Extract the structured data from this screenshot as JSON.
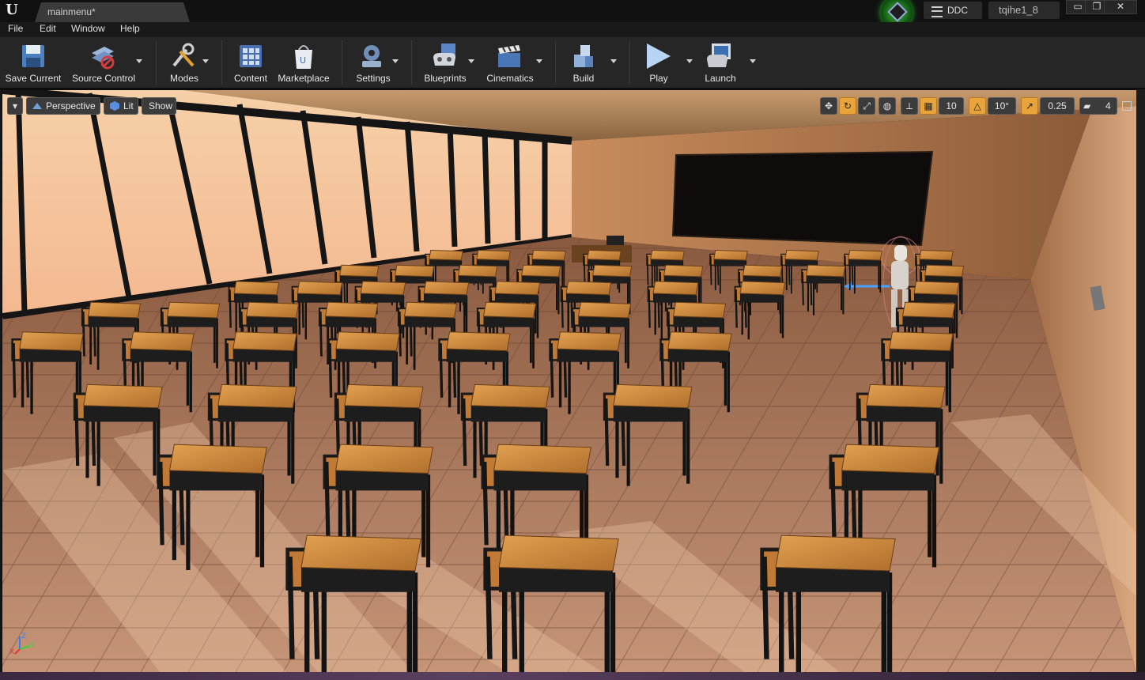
{
  "app": {
    "logo": "U"
  },
  "titlebar": {
    "tab_label": "mainmenu*",
    "feedback_icon": "ue-feedback-icon",
    "ddc_label": "DDC",
    "project_name": "tqihe1_8",
    "window_controls": [
      "▭",
      "❐",
      "✕"
    ]
  },
  "menubar": {
    "items": [
      "File",
      "Edit",
      "Window",
      "Help"
    ]
  },
  "toolbar": {
    "buttons": [
      {
        "label": "Save Current",
        "icon": "save-icon"
      },
      {
        "label": "Source Control",
        "icon": "source-control-icon"
      },
      {
        "label": "Modes",
        "icon": "modes-icon"
      },
      {
        "label": "Content",
        "icon": "content-icon"
      },
      {
        "label": "Marketplace",
        "icon": "marketplace-icon"
      },
      {
        "label": "Settings",
        "icon": "settings-icon"
      },
      {
        "label": "Blueprints",
        "icon": "blueprints-icon"
      },
      {
        "label": "Cinematics",
        "icon": "cinematics-icon"
      },
      {
        "label": "Build",
        "icon": "build-icon"
      },
      {
        "label": "Play",
        "icon": "play-icon"
      },
      {
        "label": "Launch",
        "icon": "launch-icon"
      }
    ]
  },
  "viewport": {
    "view_mode": "Perspective",
    "lighting_mode": "Lit",
    "show_label": "Show",
    "grid_snap": "10",
    "rotation_snap": "10°",
    "scale_snap": "0.25",
    "camera_speed": "4",
    "accent_color": "#e8a33a",
    "axis_labels": {
      "x": "X",
      "y": "Y",
      "z": "Z"
    }
  }
}
